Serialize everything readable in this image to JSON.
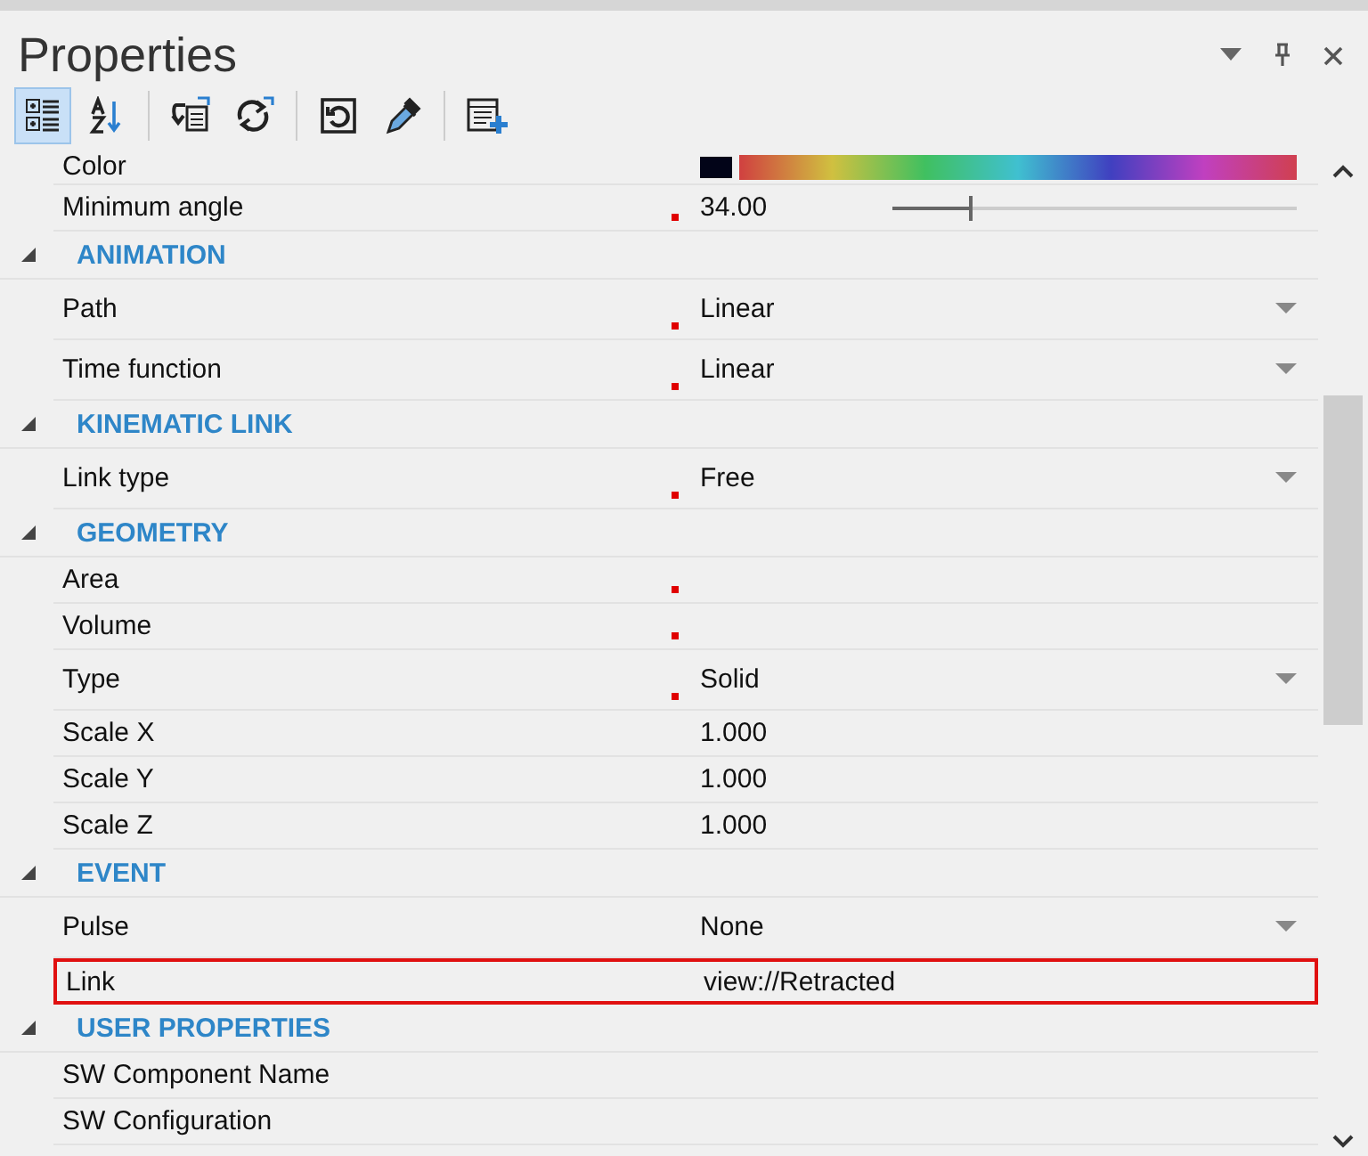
{
  "panel": {
    "title": "Properties"
  },
  "toolbar": [
    {
      "kind": "categorized",
      "selected": true
    },
    {
      "kind": "alphabetical",
      "selected": false
    },
    {
      "kind": "separator"
    },
    {
      "kind": "import",
      "selected": false
    },
    {
      "kind": "refresh",
      "selected": false
    },
    {
      "kind": "separator"
    },
    {
      "kind": "reset",
      "selected": false
    },
    {
      "kind": "eyedropper",
      "selected": false
    },
    {
      "kind": "separator"
    },
    {
      "kind": "add",
      "selected": false
    }
  ],
  "categories": [
    {
      "rows": [
        {
          "kind": "color",
          "label": "Color",
          "marked": false,
          "highlighted": false
        },
        {
          "kind": "slider",
          "label": "Minimum angle",
          "value": "34.00",
          "level": 0.19,
          "marked": true,
          "highlighted": false
        }
      ]
    },
    {
      "name": "ANIMATION",
      "expanded": true,
      "rows": [
        {
          "kind": "dropdown",
          "label": "Path",
          "value": "Linear",
          "marked": true,
          "highlighted": false
        },
        {
          "kind": "dropdown",
          "label": "Time function",
          "value": "Linear",
          "marked": true,
          "highlighted": false
        }
      ]
    },
    {
      "name": "KINEMATIC LINK",
      "expanded": true,
      "rows": [
        {
          "kind": "dropdown",
          "label": "Link type",
          "value": "Free",
          "marked": true,
          "highlighted": false
        }
      ]
    },
    {
      "name": "GEOMETRY",
      "expanded": true,
      "rows": [
        {
          "kind": "text",
          "label": "Area",
          "marked": true,
          "highlighted": false
        },
        {
          "kind": "text",
          "label": "Volume",
          "marked": true,
          "highlighted": false
        },
        {
          "kind": "dropdown",
          "label": "Type",
          "value": "Solid",
          "marked": true,
          "highlighted": false
        },
        {
          "kind": "text",
          "label": "Scale X",
          "value": "1.000",
          "marked": false,
          "highlighted": false
        },
        {
          "kind": "text",
          "label": "Scale Y",
          "value": "1.000",
          "marked": false,
          "highlighted": false
        },
        {
          "kind": "text",
          "label": "Scale Z",
          "value": "1.000",
          "marked": false,
          "highlighted": false
        }
      ]
    },
    {
      "name": "EVENT",
      "expanded": true,
      "rows": [
        {
          "kind": "dropdown",
          "label": "Pulse",
          "value": "None",
          "marked": false,
          "highlighted": false
        },
        {
          "kind": "text",
          "label": "Link",
          "value": "view://Retracted",
          "marked": false,
          "highlighted": true
        }
      ]
    },
    {
      "name": "USER PROPERTIES",
      "expanded": true,
      "rows": [
        {
          "kind": "text",
          "label": "SW Component Name",
          "marked": false,
          "highlighted": false
        },
        {
          "kind": "text",
          "label": "SW Configuration",
          "marked": false,
          "highlighted": false
        }
      ]
    }
  ]
}
